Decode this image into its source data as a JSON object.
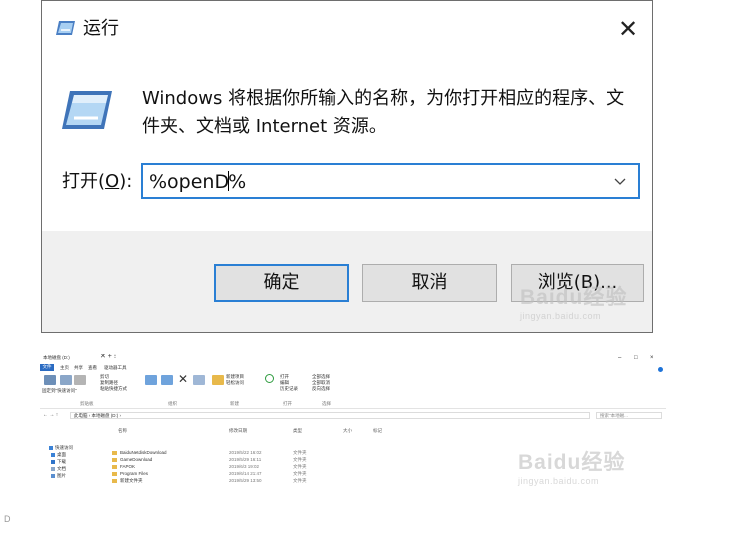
{
  "run_dialog": {
    "title": "运行",
    "close_symbol": "✕",
    "description": "Windows 将根据你所输入的名称，为你打开相应的程序、文件夹、文档或 Internet 资源。",
    "open_label_prefix": "打开(",
    "open_label_key": "O",
    "open_label_suffix": "):",
    "input_before_caret": "%openD",
    "input_after_caret": "%",
    "ok_label": "确定",
    "cancel_label": "取消",
    "browse_label": "浏览(B)...",
    "accent_color": "#2a7fd4",
    "app_icon": "run-app-icon",
    "body_icon": "run-program-icon"
  },
  "watermark": {
    "brand": "Baidu经验",
    "url": "jingyan.baidu.com"
  },
  "explorer": {
    "title": "本地磁盘 (D:)",
    "tabs": [
      "文件",
      "主页",
      "共享",
      "查看",
      "驱动器工具"
    ],
    "window_controls": [
      "–",
      "□",
      "×"
    ],
    "ribbon_groups": [
      "剪贴板",
      "组织",
      "新建",
      "打开",
      "选择"
    ],
    "ribbon_labels": {
      "pin": "固定到\"快速访问\"",
      "copy": "复制",
      "paste": "粘贴",
      "cut": "剪切",
      "copy_path": "复制路径",
      "paste_shortcut": "粘贴快捷方式",
      "move_to": "移动到",
      "copy_to": "复制到",
      "delete": "删除",
      "rename": "重命名",
      "new_folder": "新建文件夹",
      "new_item": "新建项目",
      "easy_access": "轻松访问",
      "properties": "属性",
      "open": "打开",
      "edit": "编辑",
      "history": "历史记录",
      "select_all": "全部选择",
      "select_none": "全部取消",
      "invert": "反向选择"
    },
    "address_path": "此电脑 › 本地磁盘 (D:) ›",
    "search_placeholder": "搜索\"本地磁...",
    "columns": [
      "名称",
      "修改日期",
      "类型",
      "大小",
      "标记"
    ],
    "nav_items": [
      "快速访问",
      "桌面",
      "下载",
      "文档",
      "图片"
    ],
    "rows": [
      {
        "name": "BaiduNetdiskDownload",
        "date": "2019/5/22 16:02",
        "type": "文件夹"
      },
      {
        "name": "GameDownload",
        "date": "2019/5/29 16:11",
        "type": "文件夹"
      },
      {
        "name": "FAPOK",
        "date": "2019/6/3 19:02",
        "type": "文件夹"
      },
      {
        "name": "Program Files",
        "date": "2019/6/14 21:47",
        "type": "文件夹"
      },
      {
        "name": "新建文件夹",
        "date": "2019/5/29 13:50",
        "type": "文件夹"
      }
    ]
  },
  "caption": "D"
}
